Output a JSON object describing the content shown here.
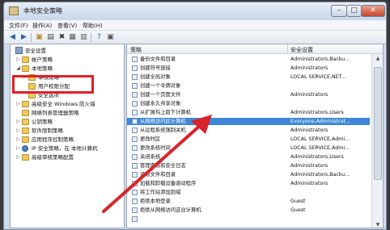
{
  "window": {
    "title": "本地安全策略"
  },
  "menu": [
    "文件(F)",
    "操作(A)",
    "查看(V)",
    "帮助(H)"
  ],
  "tree": {
    "root": "安全设置",
    "items": [
      {
        "label": "帐户策略",
        "indent": 1,
        "expand": "▷",
        "icon": "folder-icon"
      },
      {
        "label": "本地策略",
        "indent": 1,
        "expand": "◢",
        "icon": "folder-open-icon"
      },
      {
        "label": "审核策略",
        "indent": 2,
        "expand": "▷",
        "icon": "folder-icon"
      },
      {
        "label": "用户权限分配",
        "indent": 2,
        "expand": "",
        "icon": "folder-open-icon"
      },
      {
        "label": "安全选项",
        "indent": 2,
        "expand": "",
        "icon": "folder-icon"
      },
      {
        "label": "高级安全 Windows 防火墙",
        "indent": 1,
        "expand": "▷",
        "icon": "folder-icon"
      },
      {
        "label": "网络列表管理器策略",
        "indent": 1,
        "expand": "",
        "icon": "folder-icon"
      },
      {
        "label": "公钥策略",
        "indent": 1,
        "expand": "▷",
        "icon": "folder-icon"
      },
      {
        "label": "软件限制策略",
        "indent": 1,
        "expand": "▷",
        "icon": "folder-icon"
      },
      {
        "label": "应用程序控制策略",
        "indent": 1,
        "expand": "▷",
        "icon": "folder-icon"
      },
      {
        "label": "IP 安全策略，在 本地计算机",
        "indent": 1,
        "expand": "▷",
        "icon": "ip-security-icon"
      },
      {
        "label": "高级审核策略配置",
        "indent": 1,
        "expand": "▷",
        "icon": "folder-icon"
      }
    ]
  },
  "list": {
    "columns": [
      "策略",
      "安全设置"
    ],
    "rows": [
      {
        "policy": "备份文件和目录",
        "setting": "Administrators,Backu..."
      },
      {
        "policy": "创建符号链接",
        "setting": "Administrators"
      },
      {
        "policy": "创建全局对象",
        "setting": "LOCAL SERVICE,NET..."
      },
      {
        "policy": "创建一个令牌对象",
        "setting": ""
      },
      {
        "policy": "创建一个页面文件",
        "setting": "Administrators"
      },
      {
        "policy": "创建永久共享对象",
        "setting": ""
      },
      {
        "policy": "从扩展坞上取下计算机",
        "setting": "Administrators,Users"
      },
      {
        "policy": "从网络访问此计算机",
        "setting": "Everyone,Administrat...",
        "selected": true
      },
      {
        "policy": "从远程系统强制关机",
        "setting": "Administrators"
      },
      {
        "policy": "更改时区",
        "setting": "LOCAL SERVICE,Admi..."
      },
      {
        "policy": "更改系统时间",
        "setting": "LOCAL SERVICE,Admi..."
      },
      {
        "policy": "关闭系统",
        "setting": "Administrators,Users"
      },
      {
        "policy": "管理审核和安全日志",
        "setting": "Administrators"
      },
      {
        "policy": "还原文件和目录",
        "setting": "Administrators,Backu..."
      },
      {
        "policy": "加载和卸载设备驱动程序",
        "setting": "Administrators"
      },
      {
        "policy": "将工作站添加到域",
        "setting": ""
      },
      {
        "policy": "拒绝本地登录",
        "setting": "Guest"
      },
      {
        "policy": "拒绝从网络访问这台计算机",
        "setting": "Guest"
      },
      {
        "policy": "",
        "setting": ""
      }
    ]
  },
  "colors": {
    "selection": "#3e87d6",
    "highlight_box": "#e31e24",
    "arrow": "#d8242b"
  }
}
